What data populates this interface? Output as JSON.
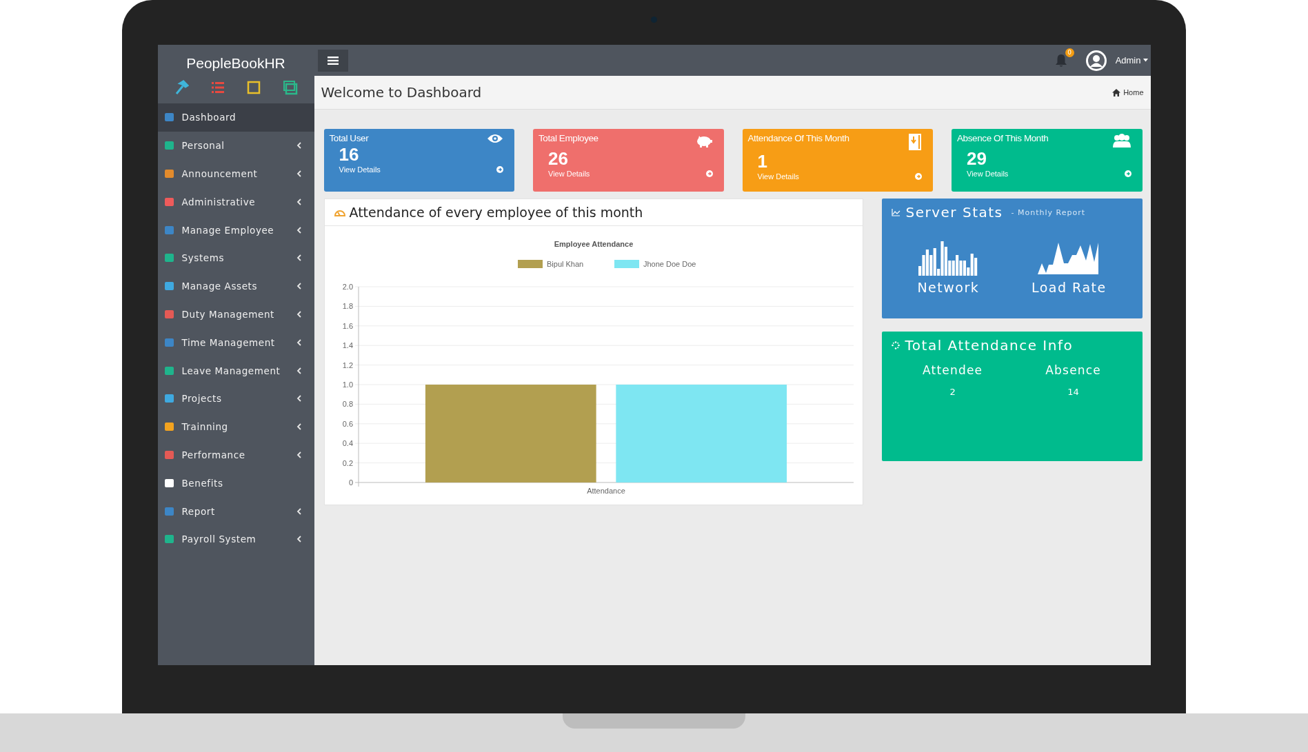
{
  "brand": "PeopleBookHR",
  "sidebar": {
    "shortcuts": [
      {
        "kind": "hammer",
        "color": "#3fb5d9"
      },
      {
        "kind": "list",
        "color": "#e8493f"
      },
      {
        "kind": "square",
        "color": "#e9c02a"
      },
      {
        "kind": "windows",
        "color": "#2bb88a"
      }
    ],
    "items": [
      {
        "label": "Dashboard",
        "selected": true,
        "expandable": false,
        "color": "#3d86c6"
      },
      {
        "label": "Personal",
        "selected": false,
        "expandable": true,
        "color": "#1fb48c"
      },
      {
        "label": "Announcement",
        "selected": false,
        "expandable": true,
        "color": "#e38b2c"
      },
      {
        "label": "Administrative",
        "selected": false,
        "expandable": true,
        "color": "#ee5b5b"
      },
      {
        "label": "Manage Employee",
        "selected": false,
        "expandable": true,
        "color": "#3d86c6"
      },
      {
        "label": "Systems",
        "selected": false,
        "expandable": true,
        "color": "#1fb48c"
      },
      {
        "label": "Manage Assets",
        "selected": false,
        "expandable": true,
        "color": "#3fa9e0"
      },
      {
        "label": "Duty Management",
        "selected": false,
        "expandable": true,
        "color": "#e45a55"
      },
      {
        "label": "Time Management",
        "selected": false,
        "expandable": true,
        "color": "#3d86c6"
      },
      {
        "label": "Leave Management",
        "selected": false,
        "expandable": true,
        "color": "#1fb48c"
      },
      {
        "label": "Projects",
        "selected": false,
        "expandable": true,
        "color": "#3fa9e0"
      },
      {
        "label": "Trainning",
        "selected": false,
        "expandable": true,
        "color": "#f3a31f"
      },
      {
        "label": "Performance",
        "selected": false,
        "expandable": true,
        "color": "#e45a55"
      },
      {
        "label": "Benefits",
        "selected": false,
        "expandable": false,
        "color": "#ffffff"
      },
      {
        "label": "Report",
        "selected": false,
        "expandable": true,
        "color": "#3d86c6"
      },
      {
        "label": "Payroll System",
        "selected": false,
        "expandable": true,
        "color": "#1fb48c"
      }
    ]
  },
  "topbar": {
    "notifications": "0",
    "user": "Admin"
  },
  "header": {
    "title": "Welcome to Dashboard",
    "breadcrumb": "Home"
  },
  "stat_cards": [
    {
      "title": "Total User",
      "value": "16",
      "link": "View Details",
      "kind": "eye",
      "color": "#3d86c6"
    },
    {
      "title": "Total Employee",
      "value": "26",
      "link": "View Details",
      "kind": "piggy",
      "color": "#ef6f6c"
    },
    {
      "title": "Attendance Of This Month",
      "value": "1",
      "link": "View Details",
      "kind": "book",
      "color": "#f79d15"
    },
    {
      "title": "Absence Of This Month",
      "value": "29",
      "link": "View Details",
      "kind": "users",
      "color": "#00bb8d"
    }
  ],
  "attendance_panel": {
    "title": "Attendance of every employee of this month",
    "chart_data": {
      "type": "bar",
      "title": "Employee Attendance",
      "categories": [
        "Attendance"
      ],
      "grid": true,
      "legend": true,
      "series": [
        {
          "name": "Bipul  Khan",
          "color": "#b29f50",
          "values": [
            1
          ]
        },
        {
          "name": "Jhone Doe  Doe",
          "color": "#7ee6f2",
          "values": [
            1
          ]
        }
      ],
      "ylim": [
        0,
        2
      ],
      "yticks": [
        {
          "value": 0,
          "label": "0"
        },
        {
          "value": 0.2,
          "label": "0.2"
        },
        {
          "value": 0.4,
          "label": "0.4"
        },
        {
          "value": 0.6,
          "label": "0.6"
        },
        {
          "value": 0.8,
          "label": "0.8"
        },
        {
          "value": 1,
          "label": "1.0"
        },
        {
          "value": 1.2,
          "label": "1.2"
        },
        {
          "value": 1.4,
          "label": "1.4"
        },
        {
          "value": 1.6,
          "label": "1.6"
        },
        {
          "value": 1.8,
          "label": "1.8"
        },
        {
          "value": 2,
          "label": "2.0"
        }
      ]
    }
  },
  "server_stats": {
    "title": "Server Stats",
    "subtitle": "- Monthly Report",
    "items": [
      {
        "label": "Network",
        "kind": "bars"
      },
      {
        "label": "Load Rate",
        "kind": "area"
      }
    ]
  },
  "attendance_info": {
    "title": "Total Attendance Info",
    "columns": [
      {
        "label": "Attendee",
        "value": "2"
      },
      {
        "label": "Absence",
        "value": "14"
      }
    ]
  }
}
